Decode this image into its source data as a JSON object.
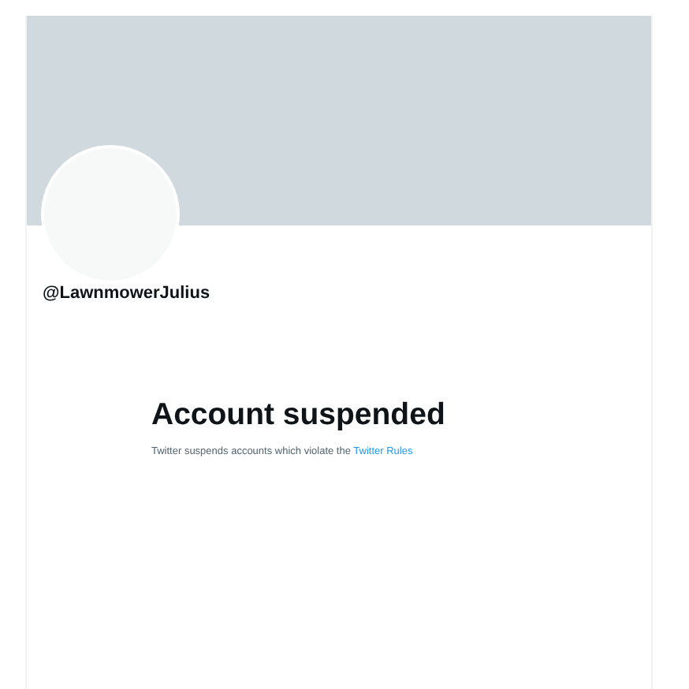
{
  "profile": {
    "handle": "@LawnmowerJulius"
  },
  "notice": {
    "title": "Account suspended",
    "text": "Twitter suspends accounts which violate the ",
    "link": "Twitter Rules"
  }
}
